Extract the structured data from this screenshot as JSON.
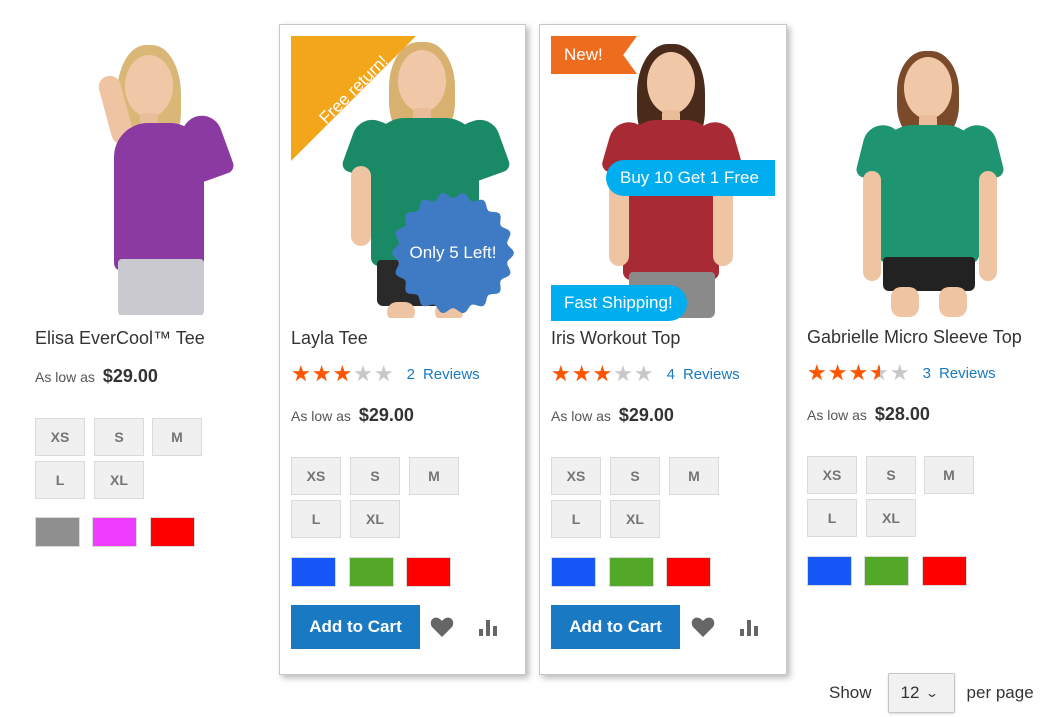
{
  "products": [
    {
      "name": "Elisa EverCool™ Tee",
      "price_prefix": "As low as",
      "price": "$29.00",
      "sizes": [
        "XS",
        "S",
        "M",
        "L",
        "XL"
      ],
      "swatches": [
        "#8f8f8f",
        "#ef3dff",
        "#ff0000"
      ],
      "shirt_color": "#8a3aa0",
      "shorts_color": "#c9c9cf"
    },
    {
      "name": "Layla Tee",
      "rating_fraction": 0.6,
      "reviews_count": "2",
      "reviews_label": "Reviews",
      "price_prefix": "As low as",
      "price": "$29.00",
      "sizes": [
        "XS",
        "S",
        "M",
        "L",
        "XL"
      ],
      "swatches": [
        "#1857f7",
        "#53a828",
        "#ff0000"
      ],
      "add_to_cart": "Add to Cart",
      "badge_corner": "Free return!",
      "badge_seal": "Only 5 Left!",
      "shirt_color": "#1a8a66",
      "shorts_color": "#2a2a2a"
    },
    {
      "name": "Iris Workout Top",
      "rating_fraction": 0.6,
      "reviews_count": "4",
      "reviews_label": "Reviews",
      "price_prefix": "As low as",
      "price": "$29.00",
      "sizes": [
        "XS",
        "S",
        "M",
        "L",
        "XL"
      ],
      "swatches": [
        "#1857f7",
        "#53a828",
        "#ff0000"
      ],
      "add_to_cart": "Add to Cart",
      "badge_new": "New!",
      "badge_promo": "Buy 10 Get 1 Free",
      "badge_shipping": "Fast Shipping!",
      "shirt_color": "#a82a35",
      "shorts_color": "#8a8a8a"
    },
    {
      "name": "Gabrielle Micro Sleeve Top",
      "rating_fraction": 0.7,
      "reviews_count": "3",
      "reviews_label": "Reviews",
      "price_prefix": "As low as",
      "price": "$28.00",
      "sizes": [
        "XS",
        "S",
        "M",
        "L",
        "XL"
      ],
      "swatches": [
        "#1857f7",
        "#53a828",
        "#ff0000"
      ],
      "shirt_color": "#1e9470",
      "shorts_color": "#222222"
    }
  ],
  "toolbar": {
    "show_label": "Show",
    "limit_value": "12",
    "per_page_label": "per page"
  },
  "colors": {
    "primary_button": "#1979c3",
    "star_active": "#ff5501",
    "link": "#1979c3"
  },
  "icons": {
    "wishlist": "heart-icon",
    "compare": "bar-chart-icon",
    "limiter": "chevron-down-icon"
  }
}
